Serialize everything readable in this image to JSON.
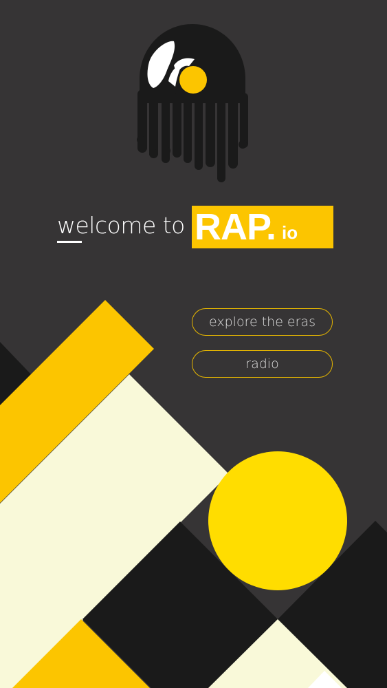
{
  "hero": {
    "welcome_text": "welcome to",
    "brand_main": "RAP.",
    "brand_suffix": "io"
  },
  "nav": {
    "buttons": [
      {
        "label": "explore the eras"
      },
      {
        "label": "radio"
      }
    ]
  },
  "colors": {
    "background": "#363435",
    "accent_yellow": "#fcc500",
    "sun_yellow": "#ffdd00",
    "cream": "#f9f9d9",
    "dark": "#1a1a1a"
  },
  "icons": {
    "logo": "dripping-vinyl-record-icon"
  }
}
